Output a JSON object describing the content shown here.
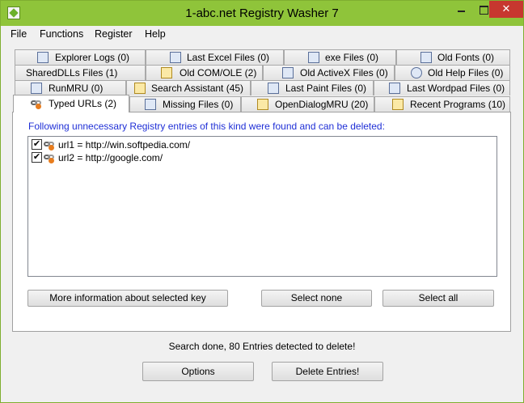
{
  "window": {
    "title": "1-abc.net Registry Washer 7",
    "close_glyph": "✕"
  },
  "menu": [
    "File",
    "Functions",
    "Register",
    "Help"
  ],
  "tabs": {
    "row1": [
      "Explorer Logs (0)",
      "Last Excel Files (0)",
      "exe Files (0)",
      "Old Fonts (0)"
    ],
    "row2": [
      "SharedDLLs Files (1)",
      "Old COM/OLE (2)",
      "Old ActiveX Files (0)",
      "Old Help Files (0)"
    ],
    "row3": [
      "RunMRU (0)",
      "Search Assistant (45)",
      "Last Paint Files (0)",
      "Last Wordpad Files (0)"
    ],
    "row4": [
      "Typed URLs (2)",
      "Missing Files (0)",
      "OpenDialogMRU (20)",
      "Recent Programs (10)"
    ]
  },
  "panel": {
    "info": "Following unnecessary Registry entries of this kind were found and can be deleted:",
    "entries": [
      {
        "checked": true,
        "text": "url1 = http://win.softpedia.com/"
      },
      {
        "checked": true,
        "text": "url2 = http://google.com/"
      }
    ],
    "check_glyph": "✔",
    "buttons": {
      "more_info": "More information about selected key",
      "select_none": "Select none",
      "select_all": "Select all"
    }
  },
  "status": "Search done, 80 Entries detected to delete!",
  "bottom": {
    "options": "Options",
    "delete": "Delete Entries!"
  },
  "colors": {
    "titlebar": "#8fc43a",
    "info_text": "#1f2fd6",
    "close_button": "#c7372f"
  }
}
